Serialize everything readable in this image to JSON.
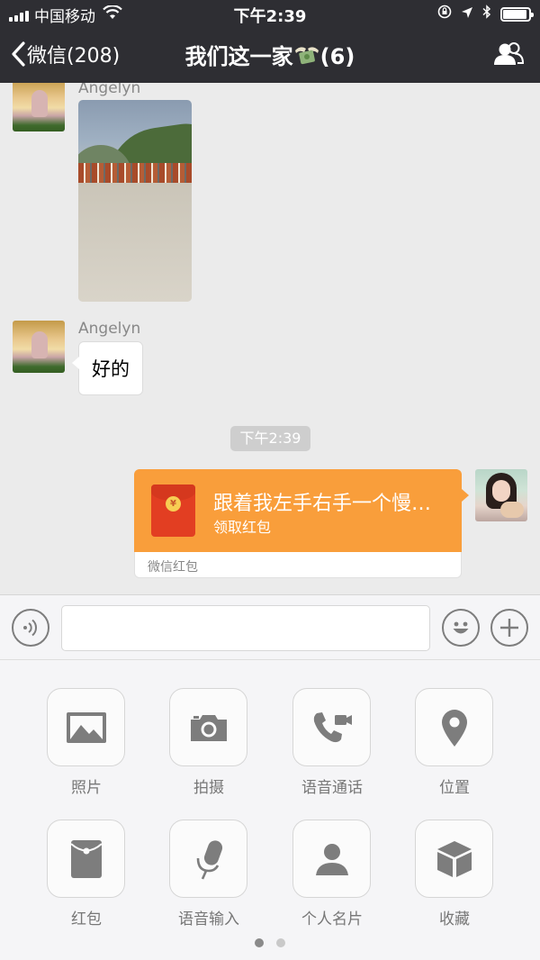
{
  "status_bar": {
    "carrier": "中国移动",
    "time": "下午2:39"
  },
  "nav": {
    "back_label": "微信(208)",
    "title_prefix": "我们这一家",
    "title_suffix": "(6)",
    "icons": {
      "back": "chevron-left-icon",
      "title_emoji": "money-with-wings-icon",
      "members": "people-icon"
    }
  },
  "chat": {
    "messages": [
      {
        "sender": "Angelyn",
        "type": "image"
      },
      {
        "sender": "Angelyn",
        "type": "text",
        "text": "好的"
      }
    ],
    "timestamp": "下午2:39",
    "red_packet": {
      "title": "跟着我左手右手一个慢…",
      "subtitle": "领取红包",
      "footer": "微信红包"
    }
  },
  "input_bar": {
    "icons": {
      "voice": "voice-icon",
      "emoji": "emoji-icon",
      "more": "plus-icon"
    },
    "value": ""
  },
  "panel": {
    "tools": [
      {
        "label": "照片",
        "icon": "photo-icon"
      },
      {
        "label": "拍摄",
        "icon": "camera-icon"
      },
      {
        "label": "语音通话",
        "icon": "video-call-icon"
      },
      {
        "label": "位置",
        "icon": "location-icon"
      },
      {
        "label": "红包",
        "icon": "red-packet-icon"
      },
      {
        "label": "语音输入",
        "icon": "microphone-icon"
      },
      {
        "label": "个人名片",
        "icon": "contact-card-icon"
      },
      {
        "label": "收藏",
        "icon": "favorites-icon"
      }
    ],
    "page_count": 2,
    "current_page": 1
  },
  "colors": {
    "nav_bg": "#2e2e33",
    "chat_bg": "#ebebeb",
    "red_packet": "#f99e3b",
    "panel_bg": "#f5f5f7",
    "icon_gray": "#7d7d7d"
  }
}
